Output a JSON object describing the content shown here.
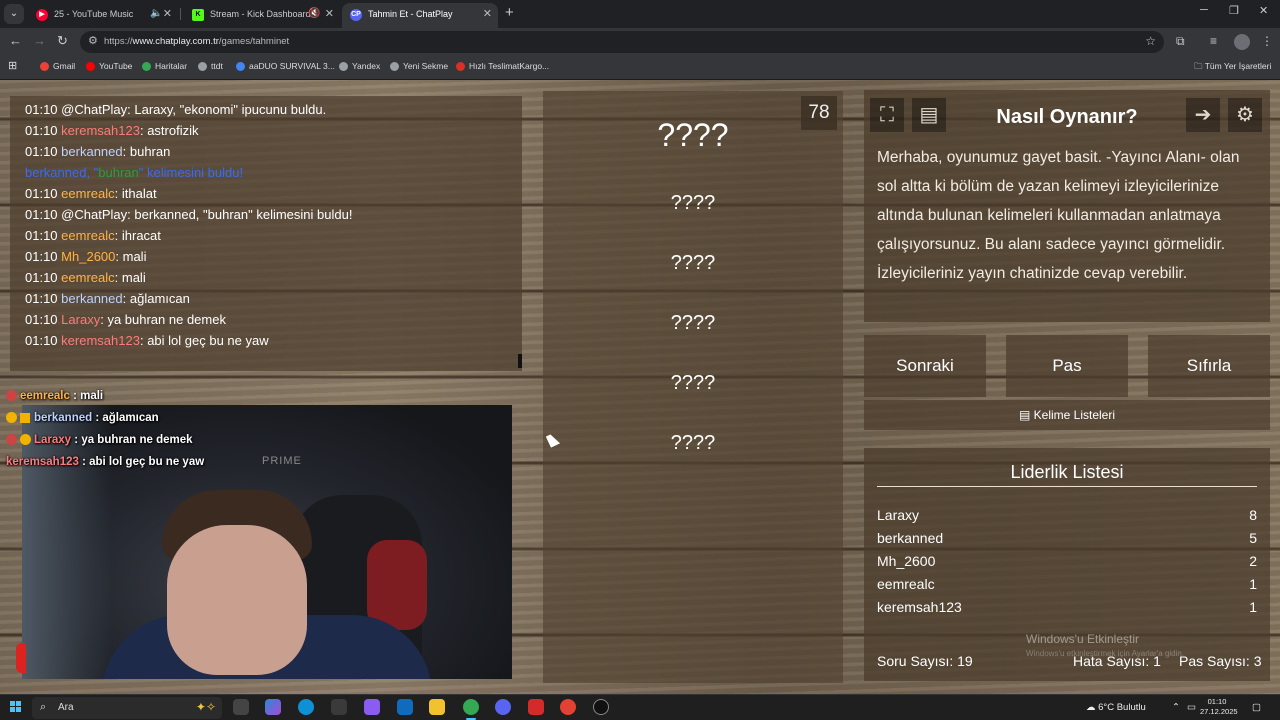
{
  "browser": {
    "tabs": [
      {
        "label": "25 - YouTube Music",
        "favicon_color": "#ff0033",
        "favicon_char": "▶"
      },
      {
        "label": "Stream - Kick Dashboard",
        "favicon_color": "#53fc18",
        "favicon_char": "K"
      },
      {
        "label": "Tahmin Et - ChatPlay",
        "favicon_color": "#5865f2",
        "favicon_char": "CP"
      }
    ],
    "url_prefix": "https://",
    "url_host": "www.chatplay.com.tr",
    "url_path": "/games/tahminet",
    "bookmarks": [
      {
        "label": "Gmail",
        "color": "#ea4335"
      },
      {
        "label": "YouTube",
        "color": "#ff0000"
      },
      {
        "label": "Haritalar",
        "color": "#34a853"
      },
      {
        "label": "ttdt",
        "color": "#9aa0a6"
      },
      {
        "label": "aaDUO SURVIVAL 3...",
        "color": "#4285f4"
      },
      {
        "label": "Yandex",
        "color": "#9aa0a6"
      },
      {
        "label": "Yeni Sekme",
        "color": "#9aa0a6"
      },
      {
        "label": "Hızlı TeslimatKargo...",
        "color": "#d93025"
      }
    ],
    "all_bookmarks": "Tüm Yer İşaretleri"
  },
  "chat": {
    "lines": [
      {
        "time": "01:10",
        "user": "@ChatPlay",
        "user_color": "#ffffff",
        "sep": ": ",
        "msg": "Laraxy, \"ekonomi\" ipucunu buldu."
      },
      {
        "time": "01:10",
        "user": "keremsah123",
        "user_color": "#ff7a7a",
        "sep": ": ",
        "msg": "astrofizik"
      },
      {
        "time": "01:10",
        "user": "berkanned",
        "user_color": "#bcd3ff",
        "sep": ": ",
        "msg": "buhran"
      },
      {
        "time": "",
        "user": "berkanned, \"",
        "user_color": "#3b6cf0",
        "sep": "",
        "msg": "buhran",
        "msg_color": "#2e9c3a",
        "tail": "\" kelimesini buldu!",
        "tail_color": "#3b6cf0"
      },
      {
        "time": "01:10",
        "user": "eemrealc",
        "user_color": "#ffb347",
        "sep": ": ",
        "msg": "ithalat"
      },
      {
        "time": "01:10",
        "user": "@ChatPlay",
        "user_color": "#ffffff",
        "sep": ": ",
        "msg": "berkanned, \"buhran\" kelimesini buldu!"
      },
      {
        "time": "01:10",
        "user": "eemrealc",
        "user_color": "#ffb347",
        "sep": ": ",
        "msg": "ihracat"
      },
      {
        "time": "01:10",
        "user": "Mh_2600",
        "user_color": "#ffb347",
        "sep": ": ",
        "msg": "mali"
      },
      {
        "time": "01:10",
        "user": "eemrealc",
        "user_color": "#ffb347",
        "sep": ": ",
        "msg": "mali"
      },
      {
        "time": "01:10",
        "user": "berkanned",
        "user_color": "#bcd3ff",
        "sep": ": ",
        "msg": "ağlamıcan"
      },
      {
        "time": "01:10",
        "user": "Laraxy",
        "user_color": "#ff7a7a",
        "sep": ": ",
        "msg": "ya buhran ne demek"
      },
      {
        "time": "01:10",
        "user": "keremsah123",
        "user_color": "#ff7a7a",
        "sep": ": ",
        "msg": "abi lol geç bu ne yaw"
      }
    ]
  },
  "overlay": {
    "lines": [
      {
        "user": "eemrealc",
        "user_color": "#ffb347",
        "msg": " : mali"
      },
      {
        "user": "berkanned",
        "user_color": "#bcd3ff",
        "msg": " : ağlamıcan"
      },
      {
        "user": "Laraxy",
        "user_color": "#ff7a7a",
        "msg": " : ya buhran ne demek"
      },
      {
        "user": "keremsah123",
        "user_color": "#ff7a7a",
        "msg": " : abi lol geç bu ne yaw"
      }
    ],
    "cam_brand": "PRIME"
  },
  "game": {
    "counter": "78",
    "words": [
      "????",
      "????",
      "????",
      "????",
      "????",
      "????"
    ]
  },
  "howto": {
    "title": "Nasıl Oynanır?",
    "text": "Merhaba, oyunumuz gayet basit. -Yayıncı Alanı- olan sol altta ki bölüm de yazan kelimeyi izleyicilerinize altında bulunan kelimeleri kullanmadan anlatmaya çalışıyorsunuz. Bu alanı sadece yayıncı görmelidir. İzleyicileriniz yayın chatinizde cevap verebilir."
  },
  "controls": {
    "next": "Sonraki",
    "pass": "Pas",
    "reset": "Sıfırla",
    "word_lists": "Kelime Listeleri"
  },
  "leaderboard": {
    "title": "Liderlik Listesi",
    "rows": [
      {
        "name": "Laraxy",
        "score": "8"
      },
      {
        "name": "berkanned",
        "score": "5"
      },
      {
        "name": "Mh_2600",
        "score": "2"
      },
      {
        "name": "eemrealc",
        "score": "1"
      },
      {
        "name": "keremsah123",
        "score": "1"
      }
    ],
    "questions": "Soru Sayısı: 19",
    "errors": "Hata Sayısı: 1",
    "passes": "Pas Sayısı: 3"
  },
  "watermark": {
    "title": "Windows'u Etkinleştir",
    "subtitle": "Windows'u etkinleştirmek için Ayarlar'a gidin."
  },
  "taskbar": {
    "search": "Ara",
    "weather": "6°C  Bulutlu",
    "time": "01:10",
    "date": "27.12.2025"
  }
}
